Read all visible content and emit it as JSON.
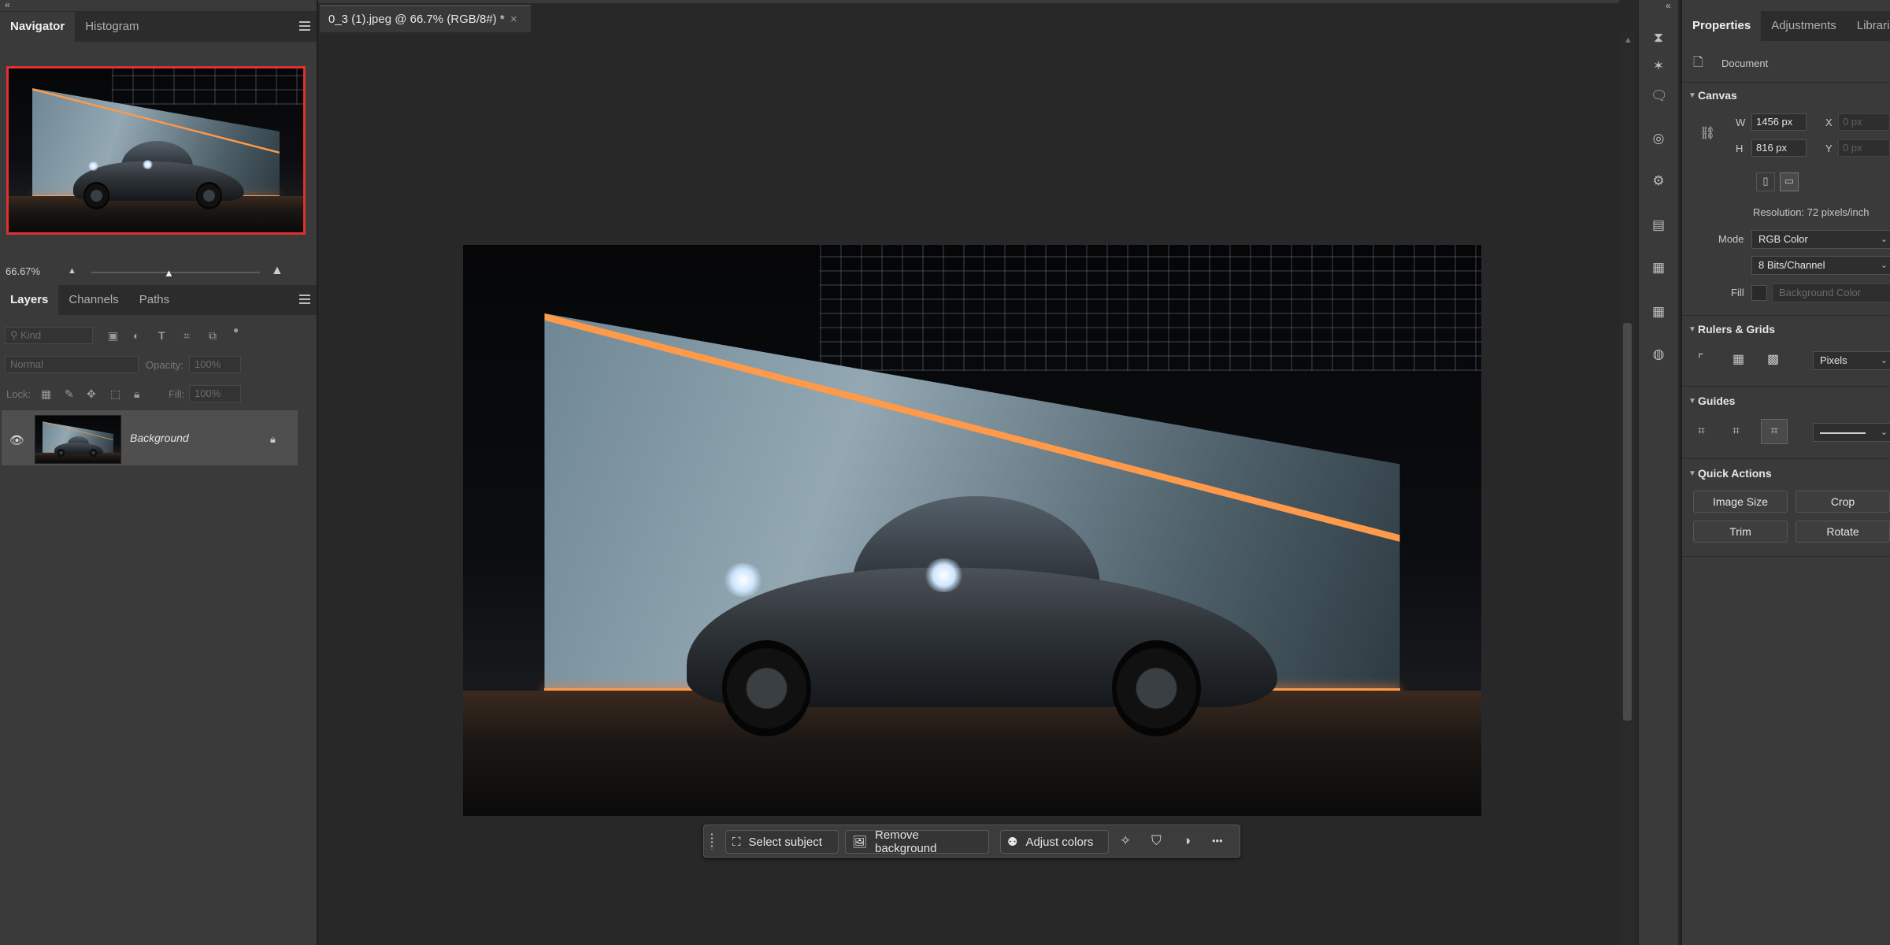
{
  "left_panel": {
    "tabs": [
      "Navigator",
      "Histogram"
    ],
    "zoom": "66.67%",
    "layers_tabs": [
      "Layers",
      "Channels",
      "Paths"
    ],
    "filter_kind": "Kind",
    "blend_mode": "Normal",
    "opacity_label": "Opacity:",
    "opacity_value": "100%",
    "lock_label": "Lock:",
    "fill_label": "Fill:",
    "fill_value": "100%",
    "layer_name": "Background"
  },
  "document": {
    "tab_title": "0_3 (1).jpeg @ 66.7% (RGB/8#) *",
    "close": "×"
  },
  "taskbar": {
    "select_subject": "Select subject",
    "remove_background": "Remove background",
    "adjust_colors": "Adjust colors",
    "more": "•••"
  },
  "properties": {
    "tabs": [
      "Properties",
      "Adjustments",
      "Libraries"
    ],
    "document_label": "Document",
    "canvas": {
      "title": "Canvas",
      "w_label": "W",
      "w_value": "1456 px",
      "h_label": "H",
      "h_value": "816 px",
      "x_label": "X",
      "x_value": "0 px",
      "y_label": "Y",
      "y_value": "0 px",
      "resolution": "Resolution: 72 pixels/inch",
      "mode_label": "Mode",
      "mode_value": "RGB Color",
      "bits_value": "8 Bits/Channel",
      "fill_label": "Fill",
      "fill_value": "Background Color"
    },
    "rulers": {
      "title": "Rulers & Grids",
      "units": "Pixels"
    },
    "guides": {
      "title": "Guides"
    },
    "quick_actions": {
      "title": "Quick Actions",
      "buttons": [
        "Image Size",
        "Crop",
        "Trim",
        "Rotate"
      ]
    }
  },
  "colors": {
    "panel_bg": "#3a3a3a",
    "workspace_bg": "#282828",
    "nav_frame": "#e03030",
    "accent_glow": "#ff9a4a"
  }
}
